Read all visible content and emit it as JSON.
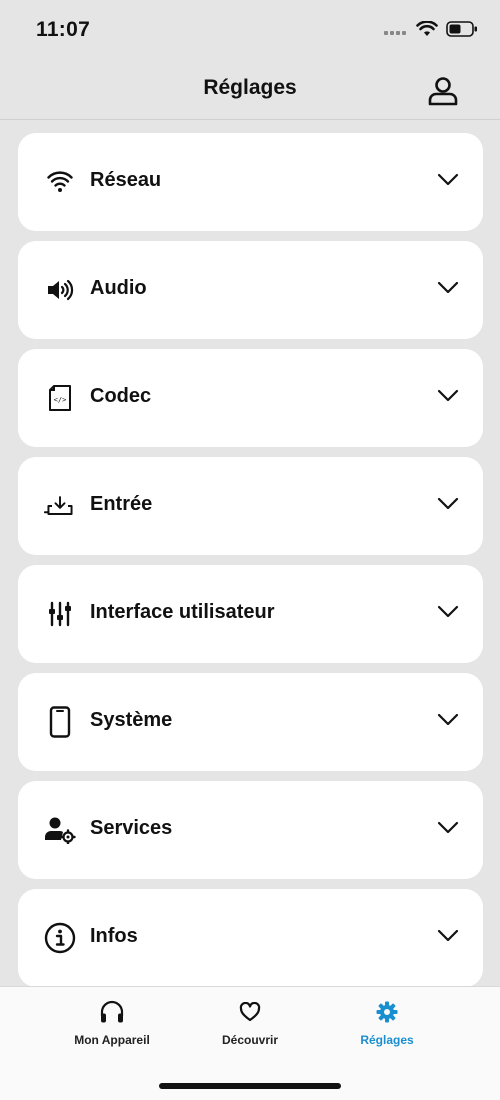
{
  "status": {
    "time": "11:07"
  },
  "header": {
    "title": "Réglages",
    "profile_icon": "user-icon"
  },
  "settings": [
    {
      "label": "Réseau",
      "icon": "wifi-icon"
    },
    {
      "label": "Audio",
      "icon": "speaker-icon"
    },
    {
      "label": "Codec",
      "icon": "codec-file-icon"
    },
    {
      "label": "Entrée",
      "icon": "input-icon"
    },
    {
      "label": "Interface utilisateur",
      "icon": "sliders-icon"
    },
    {
      "label": "Système",
      "icon": "phone-icon"
    },
    {
      "label": "Services",
      "icon": "user-gear-icon"
    },
    {
      "label": "Infos",
      "icon": "info-icon"
    }
  ],
  "tabs": [
    {
      "label": "Mon Appareil",
      "icon": "headphones-icon"
    },
    {
      "label": "Découvrir",
      "icon": "heart-icon"
    },
    {
      "label": "Réglages",
      "icon": "gear-icon",
      "active": true
    }
  ],
  "colors": {
    "accent": "#1a8fd0",
    "background": "#e5e5e5",
    "card": "#ffffff"
  }
}
